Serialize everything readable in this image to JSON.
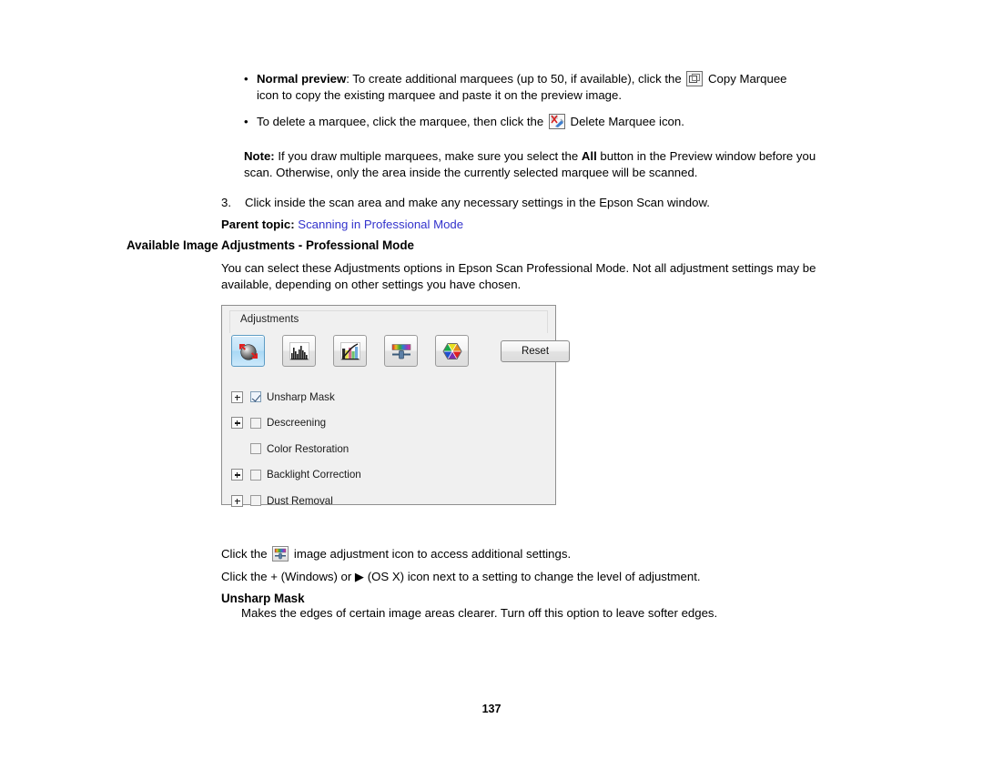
{
  "document": {
    "page_number": "137"
  },
  "bullets": [
    {
      "marker": "•",
      "bold_lead": "Normal preview",
      "text_before_icon": ": To create additional marquees (up to 50, if available), click the ",
      "icon": "copy-marquee-icon",
      "text_after_icon": " Copy Marquee icon to copy the existing marquee and paste it on the preview image."
    },
    {
      "marker": "•",
      "bold_lead": "",
      "text_before_icon": "To delete a marquee, click the marquee, then click the ",
      "icon": "delete-marquee-icon",
      "text_after_icon": " Delete Marquee icon."
    }
  ],
  "note": {
    "label": "Note:",
    "text_part1": " If you draw multiple marquees, make sure you select the ",
    "bold_word": "All",
    "text_part2": " button in the Preview window before you scan. Otherwise, only the area inside the currently selected marquee will be scanned."
  },
  "step": {
    "number": "3.",
    "text": "Click inside the scan area and make any necessary settings in the Epson Scan window."
  },
  "parent_topic": {
    "label": "Parent topic:",
    "link_text": "Scanning in Professional Mode",
    "link_color": "#3333cc"
  },
  "section": {
    "heading": "Available Image Adjustments - Professional Mode",
    "intro": "You can select these Adjustments options in Epson Scan Professional Mode. Not all adjustment settings may be available, depending on other settings you have chosen."
  },
  "dialog": {
    "group_title": "Adjustments",
    "reset_label": "Reset",
    "toolbar": [
      {
        "name": "unsharp-mask-tool-icon",
        "title": "Unsharp Mask",
        "selected": true
      },
      {
        "name": "histogram-adjustment-tool-icon",
        "title": "Histogram Adjustment",
        "selected": false
      },
      {
        "name": "tone-correction-tool-icon",
        "title": "Tone Correction",
        "selected": false
      },
      {
        "name": "image-adjustment-tool-icon",
        "title": "Image Adjustment",
        "selected": false
      },
      {
        "name": "color-palette-tool-icon",
        "title": "Color Palette",
        "selected": false
      }
    ],
    "options": [
      {
        "label": "Unsharp Mask",
        "accel": "k",
        "checked": true,
        "expandable": true
      },
      {
        "label": "Descreening",
        "accel": "e",
        "checked": false,
        "expandable": true
      },
      {
        "label": "Color Restoration",
        "accel": "o",
        "checked": false,
        "expandable": false
      },
      {
        "label": "Backlight Correction",
        "accel": "B",
        "checked": false,
        "expandable": true
      },
      {
        "label": "Dust Removal",
        "accel": "D",
        "checked": false,
        "expandable": true
      }
    ]
  },
  "footer": {
    "click_icon_line_before": "Click the ",
    "click_icon_line_after": " image adjustment icon to access additional settings.",
    "plus_line": "Click the + (Windows) or ▶ (OS X) icon next to a setting to change the level of adjustment.",
    "unsharp_heading": "Unsharp Mask",
    "unsharp_desc": "Makes the edges of certain image areas clearer. Turn off this option to leave softer edges."
  }
}
